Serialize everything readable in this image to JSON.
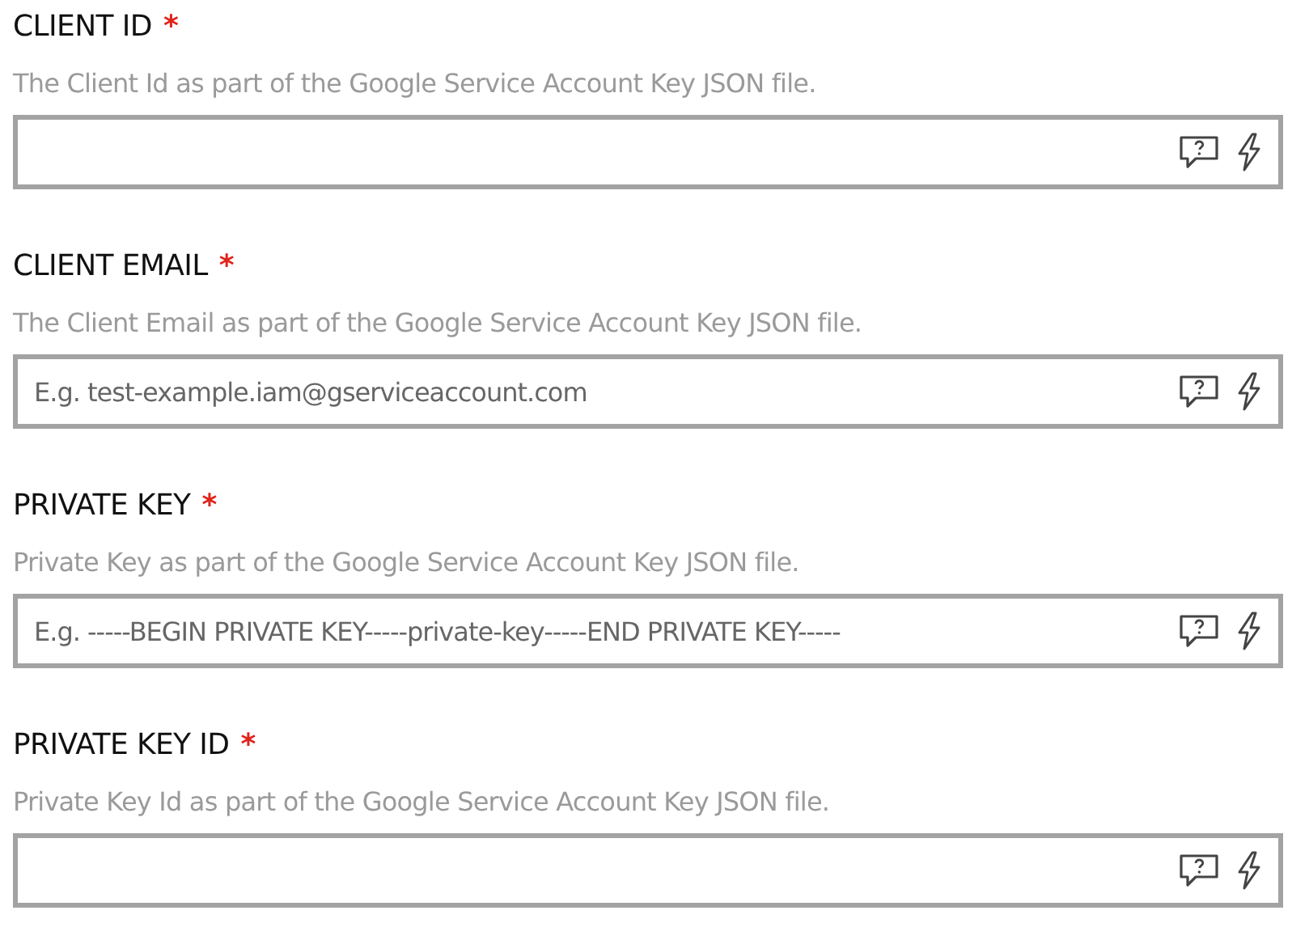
{
  "fields": [
    {
      "label": "CLIENT ID",
      "required_mark": "*",
      "description": "The Client Id as part of the Google Service Account Key JSON file."
    },
    {
      "label": "CLIENT EMAIL",
      "required_mark": "*",
      "description": "The Client Email as part of the Google Service Account Key JSON file.",
      "placeholder": "E.g. test-example.iam@gserviceaccount.com"
    },
    {
      "label": "PRIVATE KEY",
      "required_mark": "*",
      "description": "Private Key as part of the Google Service Account Key JSON file.",
      "placeholder": "E.g. -----BEGIN PRIVATE KEY-----private-key-----END PRIVATE KEY-----"
    },
    {
      "label": "PRIVATE KEY ID",
      "required_mark": "*",
      "description": "Private Key Id as part of the Google Service Account Key JSON file."
    }
  ]
}
